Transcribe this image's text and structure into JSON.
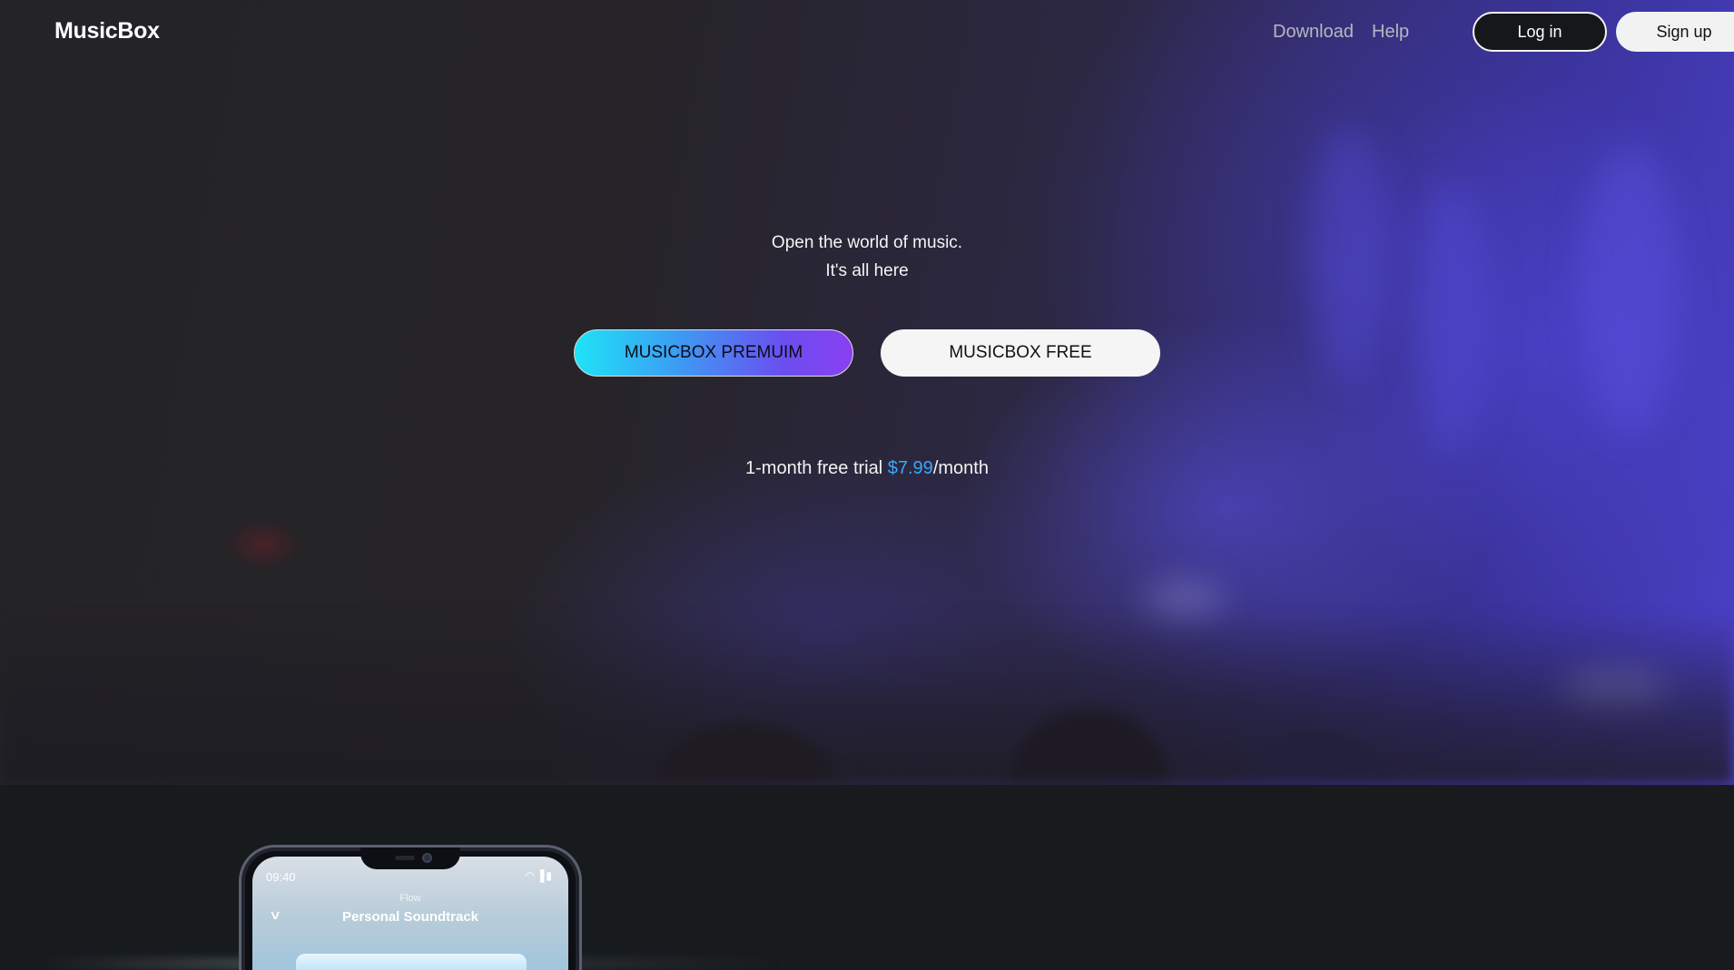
{
  "header": {
    "logo": "MusicBox",
    "nav": {
      "download": "Download",
      "help": "Help"
    },
    "login_label": "Log in",
    "signup_label": "Sign up"
  },
  "hero": {
    "tagline_line1": "Open the world of music.",
    "tagline_line2": "It's all here",
    "premium_label": "MUSICBOX PREMUIM",
    "free_label": "MUSICBOX FREE",
    "pricing": {
      "prefix": "1-month free trial ",
      "price": "$7.99",
      "suffix": "/month"
    }
  },
  "phone": {
    "time": "09:40",
    "context": "Flow",
    "playlist": "Personal Soundtrack"
  },
  "colors": {
    "price_accent": "#3aa8ff",
    "premium_gradient_start": "#1fe3f7",
    "premium_gradient_end": "#8a3ff0"
  }
}
